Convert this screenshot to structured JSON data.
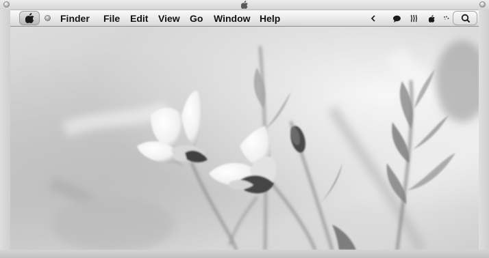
{
  "menubar": {
    "items": [
      {
        "label": "Finder"
      },
      {
        "label": "File"
      },
      {
        "label": "Edit"
      },
      {
        "label": "View"
      },
      {
        "label": "Go"
      },
      {
        "label": "Window"
      },
      {
        "label": "Help"
      }
    ],
    "apple_menu_icon": "apple-icon",
    "status_icons": [
      "chevron-left-icon",
      "speech-bubble-icon",
      "heat-waves-icon",
      "apple-icon",
      "activity-dots-icon"
    ],
    "spotlight_icon": "search-icon"
  },
  "desktop": {
    "wallpaper": "grayscale flowers photograph"
  },
  "colors": {
    "menubar_text": "#111111",
    "frame": "#d9d9d9"
  }
}
